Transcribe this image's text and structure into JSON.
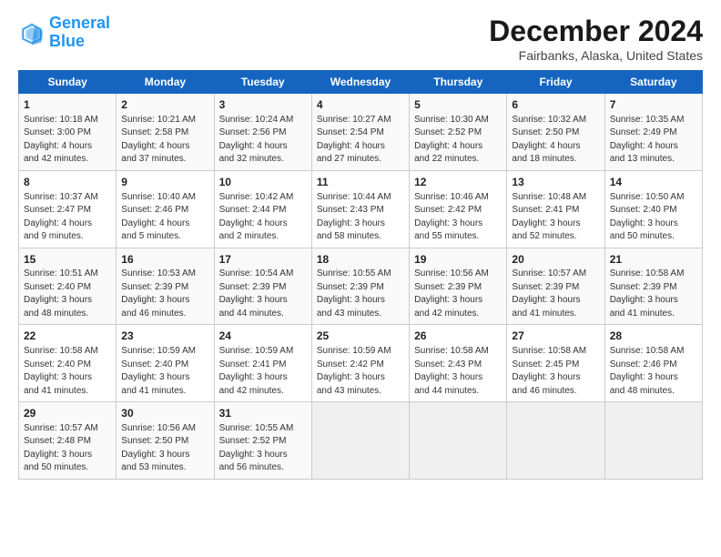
{
  "logo": {
    "line1": "General",
    "line2": "Blue"
  },
  "title": "December 2024",
  "subtitle": "Fairbanks, Alaska, United States",
  "days_of_week": [
    "Sunday",
    "Monday",
    "Tuesday",
    "Wednesday",
    "Thursday",
    "Friday",
    "Saturday"
  ],
  "weeks": [
    [
      {
        "day": "1",
        "info": "Sunrise: 10:18 AM\nSunset: 3:00 PM\nDaylight: 4 hours\nand 42 minutes."
      },
      {
        "day": "2",
        "info": "Sunrise: 10:21 AM\nSunset: 2:58 PM\nDaylight: 4 hours\nand 37 minutes."
      },
      {
        "day": "3",
        "info": "Sunrise: 10:24 AM\nSunset: 2:56 PM\nDaylight: 4 hours\nand 32 minutes."
      },
      {
        "day": "4",
        "info": "Sunrise: 10:27 AM\nSunset: 2:54 PM\nDaylight: 4 hours\nand 27 minutes."
      },
      {
        "day": "5",
        "info": "Sunrise: 10:30 AM\nSunset: 2:52 PM\nDaylight: 4 hours\nand 22 minutes."
      },
      {
        "day": "6",
        "info": "Sunrise: 10:32 AM\nSunset: 2:50 PM\nDaylight: 4 hours\nand 18 minutes."
      },
      {
        "day": "7",
        "info": "Sunrise: 10:35 AM\nSunset: 2:49 PM\nDaylight: 4 hours\nand 13 minutes."
      }
    ],
    [
      {
        "day": "8",
        "info": "Sunrise: 10:37 AM\nSunset: 2:47 PM\nDaylight: 4 hours\nand 9 minutes."
      },
      {
        "day": "9",
        "info": "Sunrise: 10:40 AM\nSunset: 2:46 PM\nDaylight: 4 hours\nand 5 minutes."
      },
      {
        "day": "10",
        "info": "Sunrise: 10:42 AM\nSunset: 2:44 PM\nDaylight: 4 hours\nand 2 minutes."
      },
      {
        "day": "11",
        "info": "Sunrise: 10:44 AM\nSunset: 2:43 PM\nDaylight: 3 hours\nand 58 minutes."
      },
      {
        "day": "12",
        "info": "Sunrise: 10:46 AM\nSunset: 2:42 PM\nDaylight: 3 hours\nand 55 minutes."
      },
      {
        "day": "13",
        "info": "Sunrise: 10:48 AM\nSunset: 2:41 PM\nDaylight: 3 hours\nand 52 minutes."
      },
      {
        "day": "14",
        "info": "Sunrise: 10:50 AM\nSunset: 2:40 PM\nDaylight: 3 hours\nand 50 minutes."
      }
    ],
    [
      {
        "day": "15",
        "info": "Sunrise: 10:51 AM\nSunset: 2:40 PM\nDaylight: 3 hours\nand 48 minutes."
      },
      {
        "day": "16",
        "info": "Sunrise: 10:53 AM\nSunset: 2:39 PM\nDaylight: 3 hours\nand 46 minutes."
      },
      {
        "day": "17",
        "info": "Sunrise: 10:54 AM\nSunset: 2:39 PM\nDaylight: 3 hours\nand 44 minutes."
      },
      {
        "day": "18",
        "info": "Sunrise: 10:55 AM\nSunset: 2:39 PM\nDaylight: 3 hours\nand 43 minutes."
      },
      {
        "day": "19",
        "info": "Sunrise: 10:56 AM\nSunset: 2:39 PM\nDaylight: 3 hours\nand 42 minutes."
      },
      {
        "day": "20",
        "info": "Sunrise: 10:57 AM\nSunset: 2:39 PM\nDaylight: 3 hours\nand 41 minutes."
      },
      {
        "day": "21",
        "info": "Sunrise: 10:58 AM\nSunset: 2:39 PM\nDaylight: 3 hours\nand 41 minutes."
      }
    ],
    [
      {
        "day": "22",
        "info": "Sunrise: 10:58 AM\nSunset: 2:40 PM\nDaylight: 3 hours\nand 41 minutes."
      },
      {
        "day": "23",
        "info": "Sunrise: 10:59 AM\nSunset: 2:40 PM\nDaylight: 3 hours\nand 41 minutes."
      },
      {
        "day": "24",
        "info": "Sunrise: 10:59 AM\nSunset: 2:41 PM\nDaylight: 3 hours\nand 42 minutes."
      },
      {
        "day": "25",
        "info": "Sunrise: 10:59 AM\nSunset: 2:42 PM\nDaylight: 3 hours\nand 43 minutes."
      },
      {
        "day": "26",
        "info": "Sunrise: 10:58 AM\nSunset: 2:43 PM\nDaylight: 3 hours\nand 44 minutes."
      },
      {
        "day": "27",
        "info": "Sunrise: 10:58 AM\nSunset: 2:45 PM\nDaylight: 3 hours\nand 46 minutes."
      },
      {
        "day": "28",
        "info": "Sunrise: 10:58 AM\nSunset: 2:46 PM\nDaylight: 3 hours\nand 48 minutes."
      }
    ],
    [
      {
        "day": "29",
        "info": "Sunrise: 10:57 AM\nSunset: 2:48 PM\nDaylight: 3 hours\nand 50 minutes."
      },
      {
        "day": "30",
        "info": "Sunrise: 10:56 AM\nSunset: 2:50 PM\nDaylight: 3 hours\nand 53 minutes."
      },
      {
        "day": "31",
        "info": "Sunrise: 10:55 AM\nSunset: 2:52 PM\nDaylight: 3 hours\nand 56 minutes."
      },
      {
        "day": "",
        "info": ""
      },
      {
        "day": "",
        "info": ""
      },
      {
        "day": "",
        "info": ""
      },
      {
        "day": "",
        "info": ""
      }
    ]
  ]
}
